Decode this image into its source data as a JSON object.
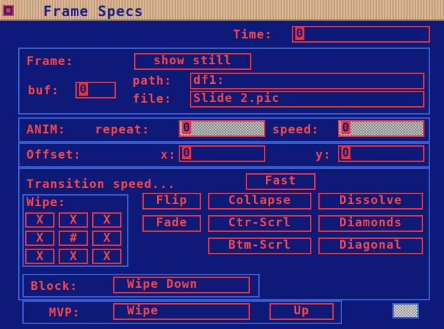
{
  "window": {
    "title": "Frame Specs"
  },
  "time": {
    "label": "Time:",
    "value": "0"
  },
  "frame": {
    "label": "Frame:",
    "mode_button": "show still",
    "buf_label": "buf:",
    "buf_value": "0",
    "path_label": "path:",
    "path_value": "df1:",
    "file_label": "file:",
    "file_value": "Slide 2.pic"
  },
  "anim": {
    "label": "ANIM:",
    "repeat_label": "repeat:",
    "repeat_value": "0",
    "speed_label": "speed:",
    "speed_value": "0"
  },
  "offset": {
    "label": "Offset:",
    "x_label": "x:",
    "x_value": "0",
    "y_label": "y:",
    "y_value": "0"
  },
  "transition": {
    "label": "Transition speed...",
    "speed_button": "Fast",
    "wipe_label": "Wipe:",
    "wipe_grid": [
      "X",
      "X",
      "X",
      "X",
      "#",
      "X",
      "X",
      "X",
      "X"
    ],
    "effects": [
      "Flip",
      "Collapse",
      "Dissolve",
      "Fade",
      "Ctr-Scrl",
      "Diamonds",
      "Btm-Scrl",
      "Diagonal"
    ]
  },
  "block": {
    "label": "Block:",
    "value": "Wipe Down"
  },
  "mvp": {
    "label": "MVP:",
    "value": "Wipe",
    "direction": "Up"
  },
  "colors": {
    "background": "#0d1a78",
    "text": "#ff4444",
    "border": "#e8323c",
    "panel_border": "#3a5ad0",
    "titlebar": "#d7b997"
  },
  "icons": {
    "close": "close-gadget-icon",
    "resize": "resize-gadget-icon"
  }
}
